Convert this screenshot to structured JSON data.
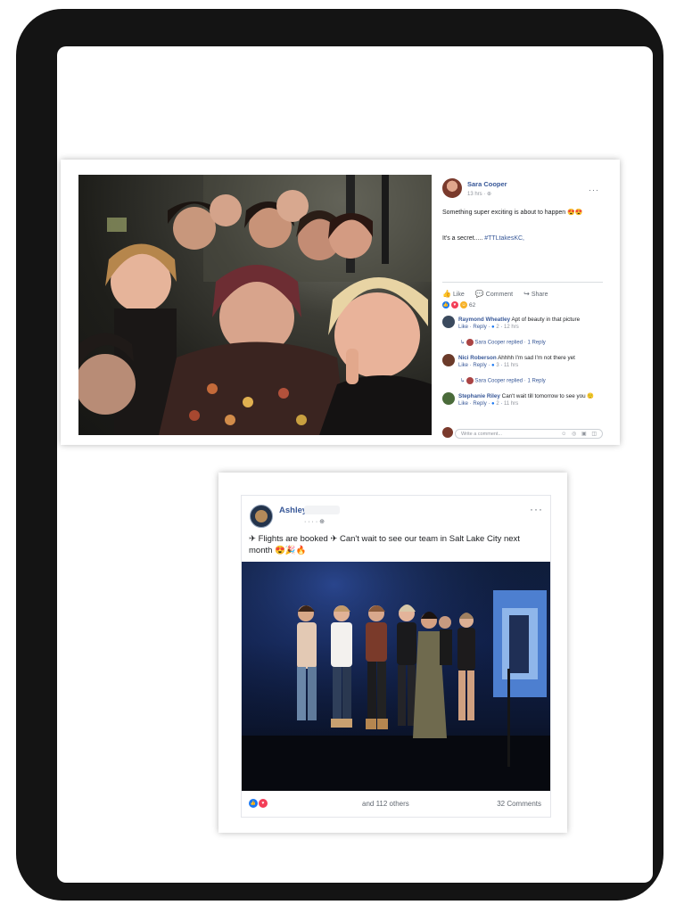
{
  "post1": {
    "author": "Sara Cooper",
    "time": "13 hrs · ",
    "globe_icon": "globe-icon",
    "text_line1": "Something super exciting is about to happen 😍😍",
    "text_line2_prefix": "It's a secret..... ",
    "hashtag": "#TTLtakesKC,",
    "actions": {
      "like": "Like",
      "comment": "Comment",
      "share": "Share"
    },
    "reaction_count": "62",
    "comments": [
      {
        "name": "Raymond Wheatley",
        "text": "Apt of beauty in that picture",
        "like": "Like",
        "reply": "Reply",
        "likes": "2",
        "time": "12 hrs",
        "reply_note": {
          "name": "Sara Cooper",
          "action": "replied",
          "count": "1 Reply"
        }
      },
      {
        "name": "Nici Roberson",
        "text": "Ahhhh I'm sad I'm not there yet",
        "like": "Like",
        "reply": "Reply",
        "likes": "3",
        "time": "11 hrs",
        "reply_note": {
          "name": "Sara Cooper",
          "action": "replied",
          "count": "1 Reply"
        }
      },
      {
        "name": "Stephanie Riley",
        "text": "Can't wait till tomorrow to see you 🙂",
        "like": "Like",
        "reply": "Reply",
        "likes": "2",
        "time": "11 hrs"
      }
    ],
    "write_placeholder": "Write a comment...",
    "write_icons": "☺ ◎ ▣ ◫"
  },
  "post2": {
    "author": "Ashley",
    "subline": "· · · · ⊕",
    "text": "✈ Flights are booked ✈ Can't wait to see our team in Salt Lake City next month 😍🎉🔥",
    "others": "and 112 others",
    "comments": "32 Comments"
  },
  "colors": {
    "link": "#385898",
    "like_blue": "#1877f2",
    "love_red": "#f33e58",
    "haha_yellow": "#f7b125"
  }
}
